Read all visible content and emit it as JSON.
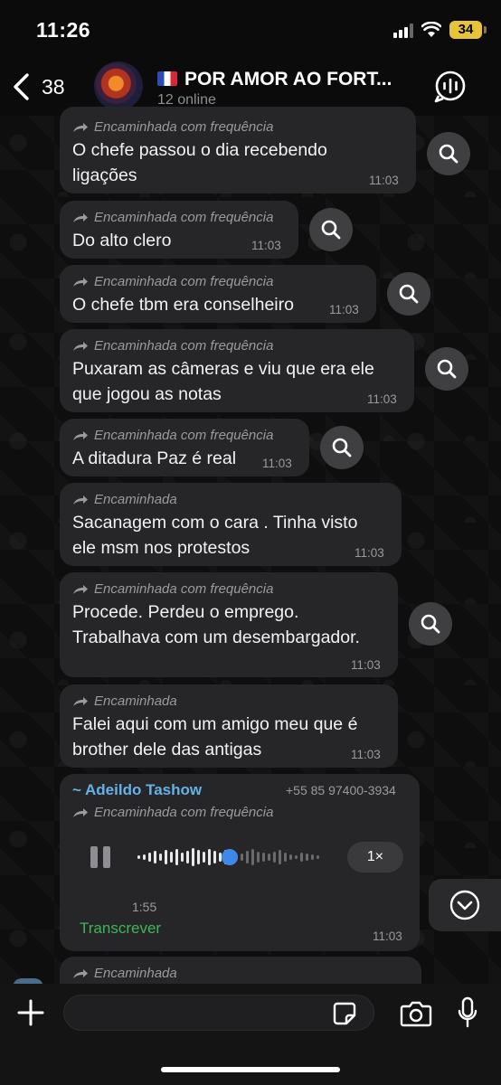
{
  "status_bar": {
    "time": "11:26",
    "battery": "34"
  },
  "header": {
    "back_count": "38",
    "title": "POR AMOR AO FORT...",
    "subtitle": "12 online"
  },
  "messages": [
    {
      "forward_label": "Encaminhada com frequência",
      "lines": [
        "O chefe passou o dia recebendo",
        "ligações"
      ],
      "time": "11:03"
    },
    {
      "forward_label": "Encaminhada com frequência",
      "lines": [
        "Do alto clero"
      ],
      "time": "11:03"
    },
    {
      "forward_label": "Encaminhada com frequência",
      "lines": [
        "O chefe tbm era conselheiro"
      ],
      "time": "11:03"
    },
    {
      "forward_label": "Encaminhada com frequência",
      "lines": [
        "Puxaram as câmeras e viu que era ele",
        "que jogou as notas"
      ],
      "time": "11:03"
    },
    {
      "forward_label": "Encaminhada com frequência",
      "lines": [
        "A ditadura Paz é real"
      ],
      "time": "11:03"
    },
    {
      "forward_label": "Encaminhada",
      "lines": [
        "Sacanagem com o cara . Tinha visto",
        "ele msm nos protestos"
      ],
      "time": "11:03"
    },
    {
      "forward_label": "Encaminhada com frequência",
      "lines": [
        "Procede. Perdeu o emprego.",
        "Trabalhava com um desembargador."
      ],
      "time": "11:03"
    },
    {
      "forward_label": "Encaminhada",
      "lines": [
        "Falei aqui com um amigo meu que é",
        "brother dele das antigas"
      ],
      "time": "11:03"
    }
  ],
  "voice_message": {
    "sender": "~ Adeildo Tashow",
    "phone": "+55 85 97400-3934",
    "forward_label": "Encaminhada com frequência",
    "duration": "1:55",
    "speed": "1×",
    "transcribe_label": "Transcrever",
    "time": "11:03",
    "progress": 0.5
  },
  "partial_message": {
    "forward_label": "Encaminhada"
  },
  "input": {
    "placeholder": ""
  },
  "colors": {
    "bubble": "#262628",
    "accent": "#3d8ae6",
    "sender": "#64b2e8",
    "transcribe": "#3fb55a"
  }
}
